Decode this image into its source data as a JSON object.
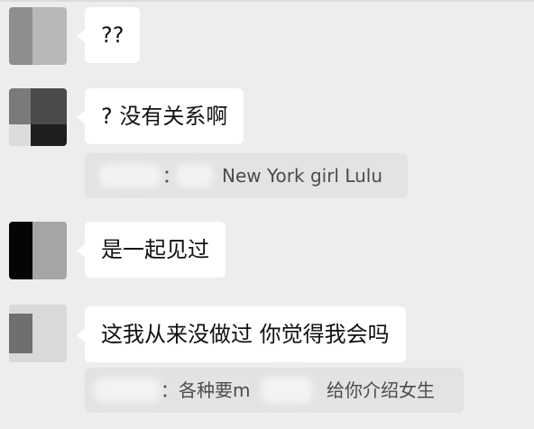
{
  "messages": [
    {
      "text": "??"
    },
    {
      "text": "? 没有关系啊"
    },
    {
      "text": "是一起见过"
    },
    {
      "text": "这我从来没做过 你觉得我会吗"
    }
  ],
  "quotes": [
    {
      "separator": "：",
      "visible_text": "New York girl Lulu"
    },
    {
      "separator": "：",
      "part1": "各种要m",
      "part2": "给你介绍女生"
    }
  ]
}
